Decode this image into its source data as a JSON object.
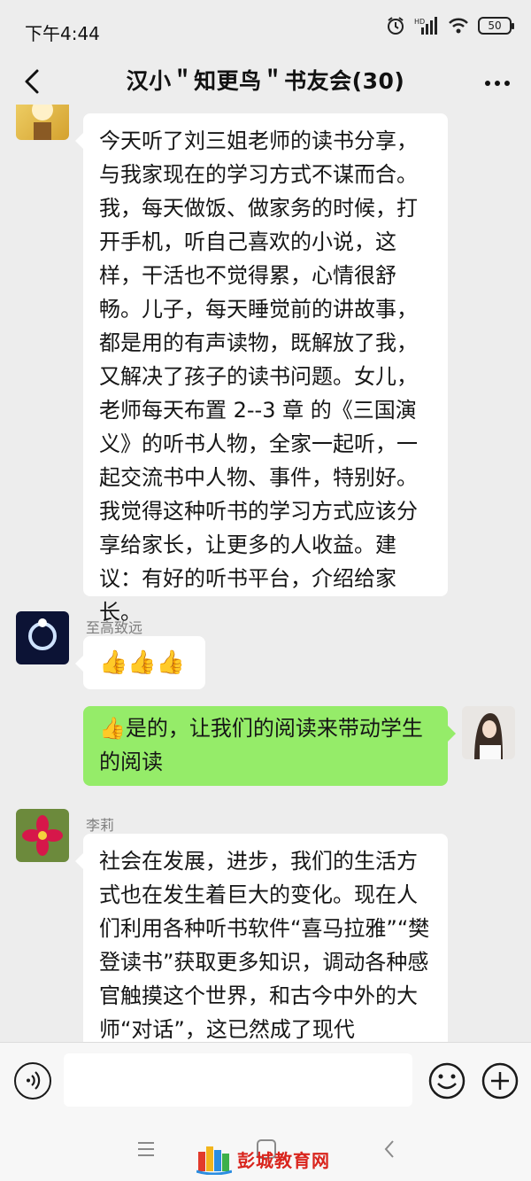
{
  "status_bar": {
    "time": "下午4:44",
    "battery": "50"
  },
  "nav": {
    "title": "汉小＂知更鸟＂书友会(30)"
  },
  "messages": [
    {
      "side": "left",
      "sender": "",
      "text": "今天听了刘三姐老师的读书分享，与我家现在的学习方式不谋而合。我，每天做饭、做家务的时候，打开手机，听自己喜欢的小说，这样，干活也不觉得累，心情很舒畅。儿子，每天睡觉前的讲故事，都是用的有声读物，既解放了我，又解决了孩子的读书问题。女儿，老师每天布置 2--3 章 的《三国演义》的听书人物，全家一起听，一起交流书中人物、事件，特别好。我觉得这种听书的学习方式应该分享给家长，让更多的人收益。建议：有好的听书平台，介绍给家长。"
    },
    {
      "side": "left",
      "sender": "至高致远",
      "text": "👍👍👍"
    },
    {
      "side": "right",
      "sender": "",
      "text": "👍是的，让我们的阅读来带动学生的阅读"
    },
    {
      "side": "left",
      "sender": "李莉",
      "text": "社会在发展，进步，我们的生活方式也在发生着巨大的变化。现在人们利用各种听书软件“喜马拉雅”“樊登读书”获取更多知识，调动各种感官触摸这个世界，和古今中外的大师“对话”，这已然成了现代"
    }
  ],
  "watermark": "彭城教育网",
  "colors": {
    "my_bubble": "#95ec69",
    "their_bubble": "#ffffff",
    "background": "#ededed"
  }
}
